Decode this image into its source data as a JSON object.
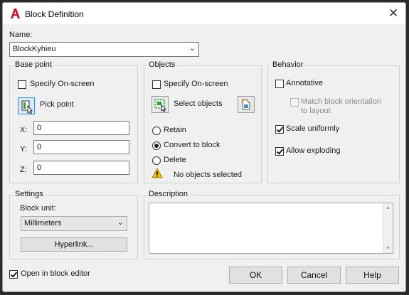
{
  "window": {
    "title": "Block Definition",
    "close_glyph": "✕"
  },
  "name": {
    "label": "Name:",
    "value": "BlockKyhieu"
  },
  "base_point": {
    "title": "Base point",
    "specify_label": "Specify On-screen",
    "pick_label": "Pick point",
    "x_label": "X:",
    "x_value": "0",
    "y_label": "Y:",
    "y_value": "0",
    "z_label": "Z:",
    "z_value": "0"
  },
  "objects": {
    "title": "Objects",
    "specify_label": "Specify On-screen",
    "select_label": "Select objects",
    "retain_label": "Retain",
    "convert_label": "Convert to block",
    "delete_label": "Delete",
    "status_text": "No objects selected"
  },
  "behavior": {
    "title": "Behavior",
    "annotative_label": "Annotative",
    "match_label_1": "Match block orientation",
    "match_label_2": "to layout",
    "scale_label": "Scale uniformly",
    "explode_label": "Allow exploding"
  },
  "settings": {
    "title": "Settings",
    "unit_label": "Block unit:",
    "unit_value": "Millimeters",
    "hyperlink_label": "Hyperlink..."
  },
  "description": {
    "title": "Description"
  },
  "footer": {
    "open_editor_label": "Open in block editor",
    "ok_label": "OK",
    "cancel_label": "Cancel",
    "help_label": "Help"
  },
  "colors": {
    "accent": "#c8102e",
    "dialog_bg": "#f0f0f0",
    "warning": "#f2c200"
  }
}
